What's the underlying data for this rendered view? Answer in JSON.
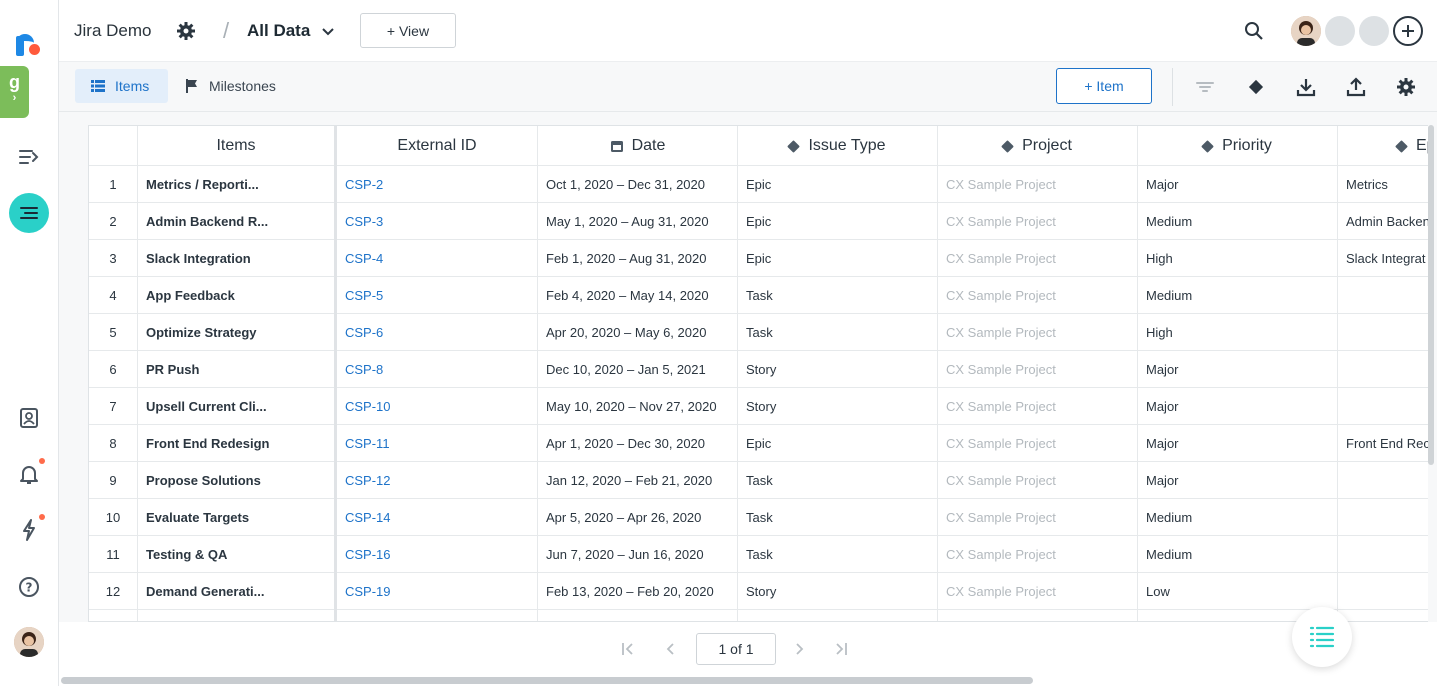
{
  "header": {
    "project_title": "Jira Demo",
    "separator": "/",
    "view_title": "All Data",
    "view_button_label": "+ View"
  },
  "toolbar": {
    "tabs": [
      {
        "label": "Items",
        "active": true
      },
      {
        "label": "Milestones",
        "active": false
      }
    ],
    "add_item_label": "+ Item"
  },
  "table": {
    "columns": [
      "Items",
      "External ID",
      "Date",
      "Issue Type",
      "Project",
      "Priority",
      "Epi"
    ],
    "rows": [
      {
        "num": "1",
        "item": "Metrics / Reporti...",
        "external_id": "CSP-2",
        "date": "Oct 1, 2020 – Dec 31, 2020",
        "issue_type": "Epic",
        "project": "CX Sample Project",
        "priority": "Major",
        "epic": "Metrics"
      },
      {
        "num": "2",
        "item": "Admin Backend R...",
        "external_id": "CSP-3",
        "date": "May 1, 2020 – Aug 31, 2020",
        "issue_type": "Epic",
        "project": "CX Sample Project",
        "priority": "Medium",
        "epic": "Admin Backen"
      },
      {
        "num": "3",
        "item": "Slack Integration",
        "external_id": "CSP-4",
        "date": "Feb 1, 2020 – Aug 31, 2020",
        "issue_type": "Epic",
        "project": "CX Sample Project",
        "priority": "High",
        "epic": "Slack Integrat"
      },
      {
        "num": "4",
        "item": "App Feedback",
        "external_id": "CSP-5",
        "date": "Feb 4, 2020 – May 14, 2020",
        "issue_type": "Task",
        "project": "CX Sample Project",
        "priority": "Medium",
        "epic": ""
      },
      {
        "num": "5",
        "item": "Optimize Strategy",
        "external_id": "CSP-6",
        "date": "Apr 20, 2020 – May 6, 2020",
        "issue_type": "Task",
        "project": "CX Sample Project",
        "priority": "High",
        "epic": ""
      },
      {
        "num": "6",
        "item": "PR Push",
        "external_id": "CSP-8",
        "date": "Dec 10, 2020 – Jan 5, 2021",
        "issue_type": "Story",
        "project": "CX Sample Project",
        "priority": "Major",
        "epic": ""
      },
      {
        "num": "7",
        "item": "Upsell Current Cli...",
        "external_id": "CSP-10",
        "date": "May 10, 2020 – Nov 27, 2020",
        "issue_type": "Story",
        "project": "CX Sample Project",
        "priority": "Major",
        "epic": ""
      },
      {
        "num": "8",
        "item": "Front End Redesign",
        "external_id": "CSP-11",
        "date": "Apr 1, 2020 – Dec 30, 2020",
        "issue_type": "Epic",
        "project": "CX Sample Project",
        "priority": "Major",
        "epic": "Front End Rec"
      },
      {
        "num": "9",
        "item": "Propose Solutions",
        "external_id": "CSP-12",
        "date": "Jan 12, 2020 – Feb 21, 2020",
        "issue_type": "Task",
        "project": "CX Sample Project",
        "priority": "Major",
        "epic": ""
      },
      {
        "num": "10",
        "item": "Evaluate Targets",
        "external_id": "CSP-14",
        "date": "Apr 5, 2020 – Apr 26, 2020",
        "issue_type": "Task",
        "project": "CX Sample Project",
        "priority": "Medium",
        "epic": ""
      },
      {
        "num": "11",
        "item": "Testing & QA",
        "external_id": "CSP-16",
        "date": "Jun 7, 2020 – Jun 16, 2020",
        "issue_type": "Task",
        "project": "CX Sample Project",
        "priority": "Medium",
        "epic": ""
      },
      {
        "num": "12",
        "item": "Demand Generati...",
        "external_id": "CSP-19",
        "date": "Feb 13, 2020 – Feb 20, 2020",
        "issue_type": "Story",
        "project": "CX Sample Project",
        "priority": "Low",
        "epic": ""
      }
    ]
  },
  "pagination": {
    "page_label": "1 of 1"
  },
  "colors": {
    "accent": "#1e73c9",
    "rail_active": "#2ad0c8",
    "notification": "#ff6b4a",
    "extension": "#7cbd5a"
  },
  "icons": {
    "rail": [
      "logo-icon",
      "extension-icon",
      "roadmap-icon",
      "items-list-icon",
      "contacts-icon",
      "bell-icon",
      "lightning-icon",
      "help-icon"
    ],
    "toolbar": [
      "filter-icon",
      "diamond-icon",
      "download-icon",
      "upload-icon",
      "gear-icon"
    ]
  }
}
